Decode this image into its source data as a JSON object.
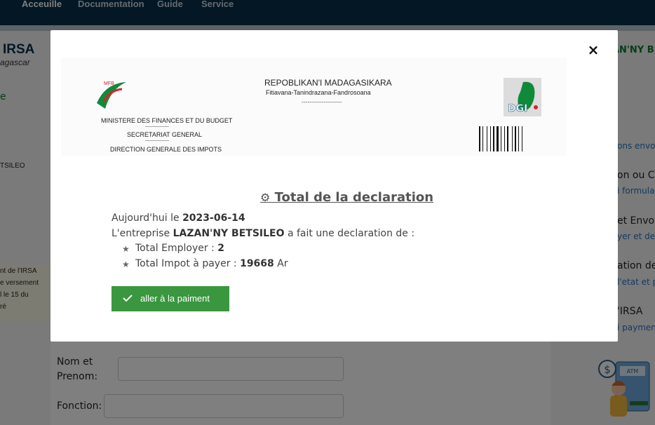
{
  "nav": {
    "items": [
      "Acceuille",
      "Documentation",
      "Guide",
      "Service"
    ]
  },
  "background": {
    "brand": "IRSA",
    "brand_sub": "agascar",
    "left_link": "e",
    "left_company": "TSILEO",
    "left_note_lines": [
      "nt de l'IRSA",
      "e versement",
      "l le 15 du",
      "ré"
    ],
    "right_company": "AN'NY B",
    "right_items": [
      {
        "title": "",
        "link": "ons envoye"
      },
      {
        "title": "on ou Ca",
        "link": "i formulair"
      },
      {
        "title": "et Envoy",
        "link": "yer et decl"
      },
      {
        "title": "ation de",
        "link": "l'etat et p"
      },
      {
        "title": "'IRSA",
        "link": "i payment"
      }
    ],
    "form": {
      "nom_label_1": "Nom et",
      "nom_label_2": "Prenom:",
      "fonction_label": "Fonction:"
    }
  },
  "modal": {
    "close_label": "×",
    "letterhead": {
      "logo_text": "MFB",
      "ministry": "MINISTERE DES FINANCES ET DU BUDGET",
      "sep1": "-----------------",
      "secretariat": "SECRETARIAT GENERAL",
      "sep2": "-----------------",
      "direction": "DIRECTION GENERALE DES IMPOTS",
      "republic": "REPOBLIKAN'I MADAGASIKARA",
      "motto": "Fitiavana-Tanindrazana-Fandrosoana",
      "motto_sep": "--------------------",
      "dgi_logo": "DGI"
    },
    "title": "Total de la declaration",
    "date_prefix": "Aujourd'hui le ",
    "date": "2023-06-14",
    "company_prefix": "L'entreprise ",
    "company": "LAZAN'NY BETSILEO",
    "company_suffix": " a fait une declaration de :",
    "employer_label": "Total Employer : ",
    "employer_value": "2",
    "impot_label": "Total Impot à payer : ",
    "impot_value": "19668",
    "impot_unit": " Ar",
    "pay_button": "aller à la paiment"
  },
  "colors": {
    "nav": "#062f48",
    "button": "#3a963f",
    "link": "#2474c5",
    "green_text": "#0a7a2a"
  }
}
